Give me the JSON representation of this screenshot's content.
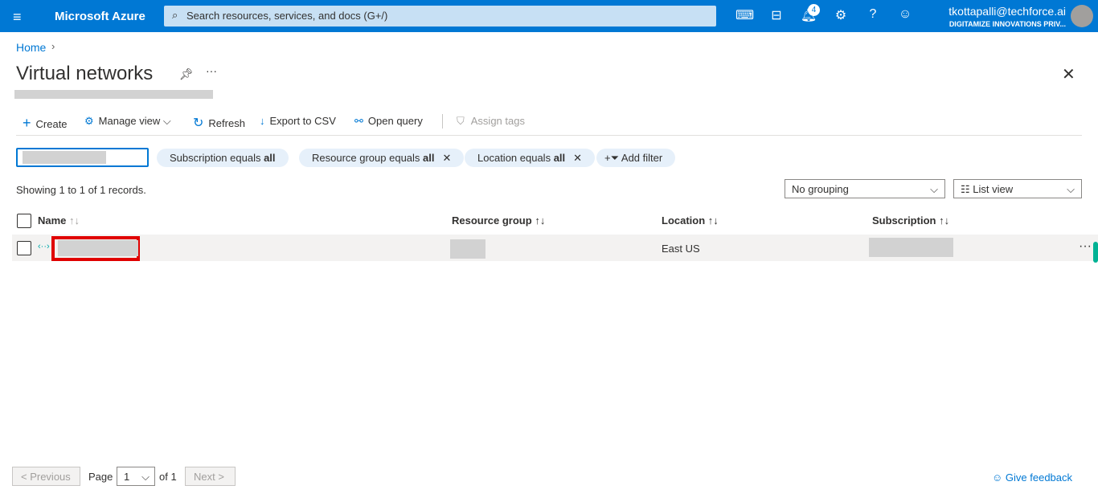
{
  "topbar": {
    "brand": "Microsoft Azure",
    "search_placeholder": "Search resources, services, and docs (G+/)",
    "notification_count": "4",
    "user_email": "tkottapalli@techforce.ai",
    "user_org": "DIGITAMIZE INNOVATIONS PRIV..."
  },
  "breadcrumb": {
    "home": "Home"
  },
  "page": {
    "title": "Virtual networks"
  },
  "toolbar": {
    "create": "Create",
    "manage_view": "Manage view",
    "refresh": "Refresh",
    "export": "Export to CSV",
    "open_query": "Open query",
    "assign_tags": "Assign tags"
  },
  "filters": {
    "subscription": "Subscription equals ",
    "resource_group": "Resource group equals ",
    "location": "Location equals ",
    "value": "all",
    "add_filter": "Add filter"
  },
  "records": "Showing 1 to 1 of 1 records.",
  "grouping": "No grouping",
  "view": "List view",
  "table": {
    "headers": [
      "Name",
      "Resource group",
      "Location",
      "Subscription"
    ],
    "rows": [
      {
        "location": "East US"
      }
    ]
  },
  "pagination": {
    "previous": "< Previous",
    "page_label": "Page",
    "page": "1",
    "of": "of 1",
    "next": "Next >"
  },
  "feedback": "Give feedback",
  "colors": {
    "brand": "#0078d4",
    "highlight": "#e00000"
  }
}
